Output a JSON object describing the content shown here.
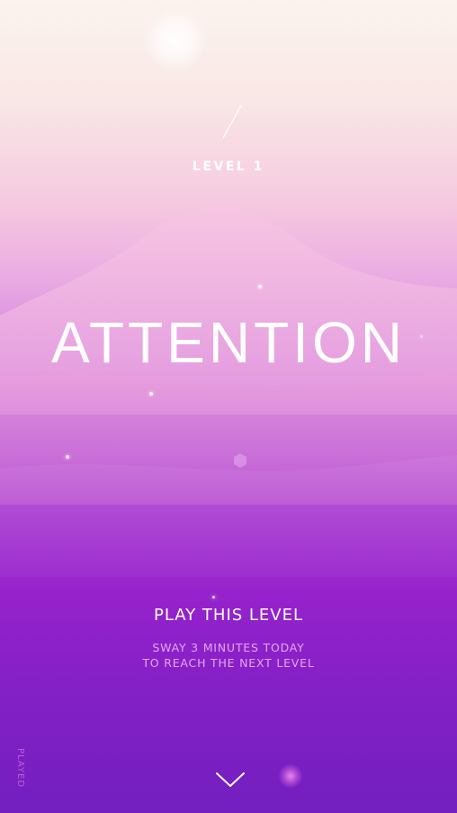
{
  "level": {
    "label": "LEVEL 1",
    "title": "ATTENTION"
  },
  "actions": {
    "play_label": "PLAY THIS LEVEL",
    "subtitle_line1": "SWAY 3 MINUTES TODAY",
    "subtitle_line2": "TO REACH THE NEXT LEVEL"
  },
  "status": {
    "played_label": "PLAYED"
  },
  "icons": {
    "separator": "slash-icon",
    "next": "chevron-down-icon",
    "sparkle": "hexagon-sparkle-icon"
  },
  "colors": {
    "top": "#fbf3ee",
    "mid": "#d98ce0",
    "bottom": "#731fbf",
    "subtitle": "#e7a6f0",
    "played": "#c45ad9"
  }
}
